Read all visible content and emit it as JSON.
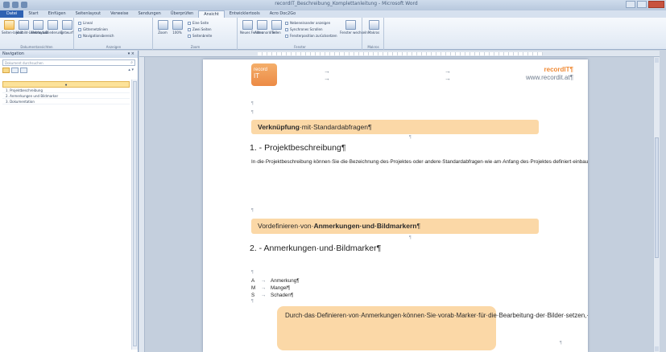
{
  "titlebar": {
    "title": "recordIT_Beschreibung_Komplettanleitung - Microsoft Word"
  },
  "tabs": [
    "Datei",
    "Start",
    "Einfügen",
    "Seitenlayout",
    "Verweise",
    "Sendungen",
    "Überprüfen",
    "Ansicht",
    "Entwicklertools",
    "Acro Doc2Go"
  ],
  "ribbon": {
    "groups": [
      "Dokumentansichten",
      "Anzeigen",
      "Zoom",
      "Fenster",
      "Makros"
    ],
    "buttons": {
      "seitenlayout": "Seiten-layout",
      "vollbild": "Vollbild-Lesemodus",
      "weblayout": "Weblayout",
      "gliederung": "Gliederung",
      "entwurf": "Entwurf",
      "zoom": "Zoom",
      "hundert": "100%",
      "neues_fenster": "Neues Fenster",
      "alle_anordnen": "Alle anordnen",
      "teilen": "Teilen",
      "fenster_wechseln": "Fenster wechseln",
      "makros": "Makros"
    },
    "checks": [
      "Lineal",
      "Gitternetzlinien",
      "Navigationsbereich"
    ],
    "zoom_checks": [
      "Eine Seite",
      "Zwei Seiten",
      "Seitenbreite"
    ],
    "window_checks": [
      "Nebeneinander anzeigen",
      "Synchrones Scrollen",
      "Fensterposition zurücksetzen"
    ]
  },
  "nav": {
    "title": "Navigation",
    "search_placeholder": "Dokument durchsuchen",
    "selected": "♦",
    "items": [
      "1. Projektbeschreibung",
      "2. Anmerkungen und Bildmarker",
      "3. Dokumentation"
    ]
  },
  "doc": {
    "logo_top": "record",
    "logo_bottom": "IT",
    "brand": "recordIT¶",
    "url": "www.recordit.at¶",
    "box1_bold": "Verknüpfung",
    "box1_rest": "·mit·Standardabfragen¶",
    "h1": "1. - Projektbeschreibung¶",
    "para": "In·die·Projektbeschreibung·können·Sie·die·Bezeichnung·des·Projektes·oder·andere·Standardabfragen·wie·am·Anfang·des·Projektes·definiert·einbauen.·Daraus·ergibt·sich,·dass·ein·bisher·zeitaufwendiges·und·fehleranfälliges·Korrigieren·der·Projektbeschreibung·entfällt.·Bisher·bekannt·Strukturen·bleiben·erhalten,·jedoch·kann·die·gesparte·Zeit·in·die·Bearbeitung·der·wichtigen·Berichtspunkte·einfließen.¶",
    "box2_rest": "Vordefinieren·von·",
    "box2_bold": "Anmerkungen·und·Bildmarkern",
    "box2_end": "¶",
    "h2": "2. - Anmerkungen·und·Bildmarker¶",
    "list": [
      {
        "k": "A",
        "v": "Anmerkung¶"
      },
      {
        "k": "M",
        "v": "Mangel¶"
      },
      {
        "k": "S",
        "v": "Schaden¶"
      }
    ],
    "box3": "Durch·das·Definieren·von·Anmerkungen·können·Sie·vorab·Marker·für·die·Bearbeitung·der·Bilder·setzen,·welche·zu·einer·Vereinfachung·der·Erfassung·der·Bildinhalte·führt.¶"
  }
}
